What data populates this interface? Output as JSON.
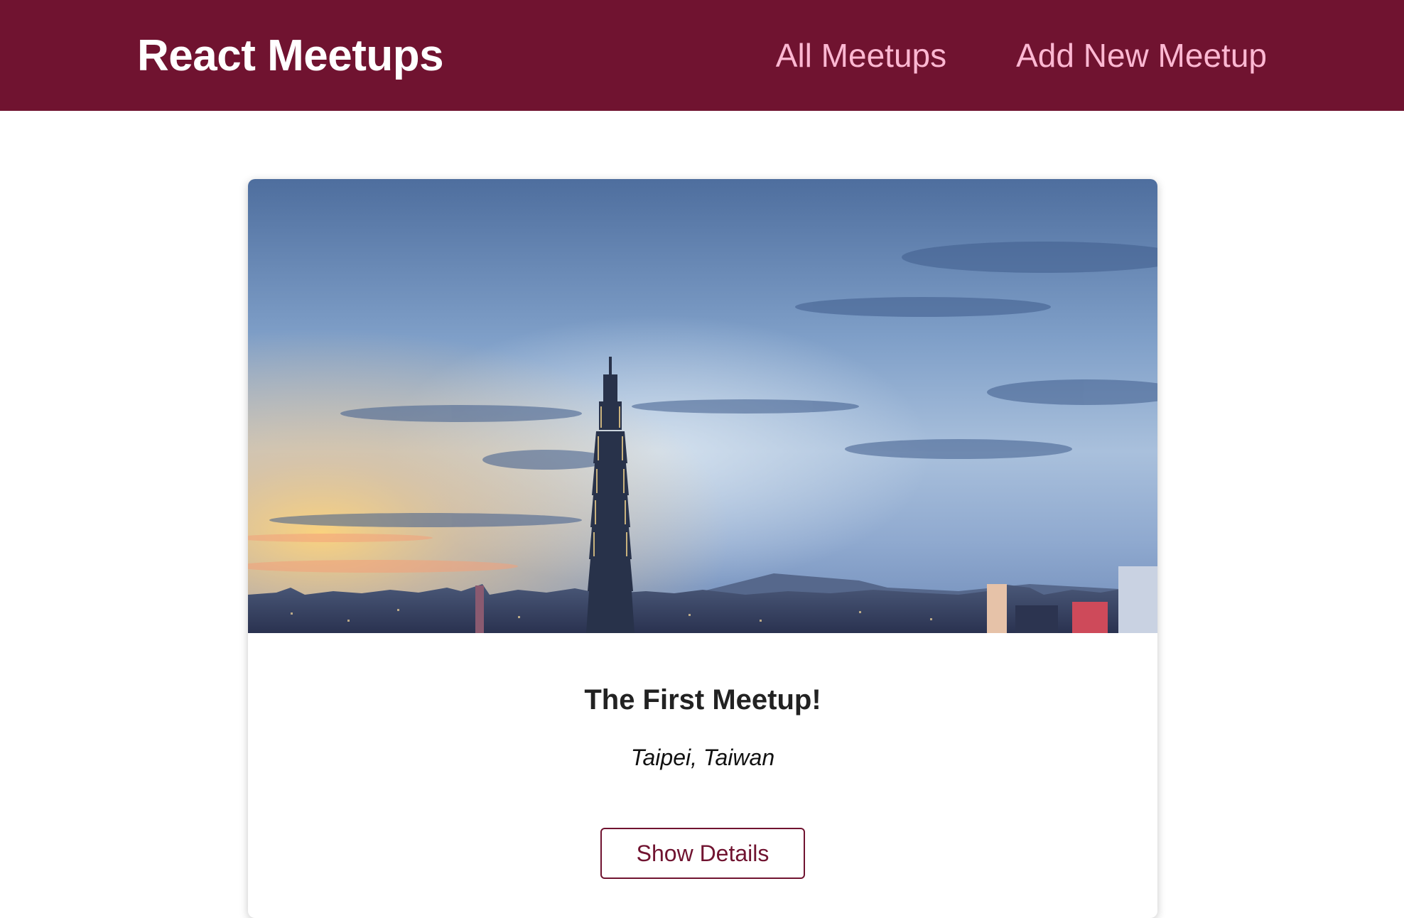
{
  "header": {
    "logo": "React Meetups",
    "nav": [
      {
        "label": "All Meetups"
      },
      {
        "label": "Add New Meetup"
      }
    ]
  },
  "colors": {
    "brand": "#701330",
    "nav_link": "#fcb8d2",
    "button_text": "#701330"
  },
  "meetup": {
    "image_subject": "Taipei city skyline at dusk with tall tower",
    "title": "The First Meetup!",
    "address": "Taipei, Taiwan",
    "button_label": "Show Details"
  }
}
